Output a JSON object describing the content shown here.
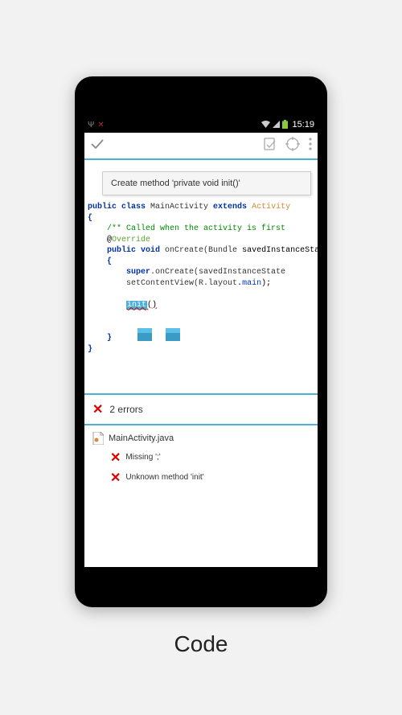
{
  "status_bar": {
    "clock": "15:19"
  },
  "toolbar": {},
  "suggestion": {
    "text": "Create method 'private void init()'"
  },
  "code": {
    "l1a": "public",
    "l1b": " class",
    "l1c": " MainActivity",
    "l1d": " extends",
    "l1e": " Activity",
    "l2": "{",
    "l3": "    /** Called when the activity is first",
    "l4a": "    @",
    "l4b": "Override",
    "l5a": "    public",
    "l5b": " void",
    "l5c": " onCreate(",
    "l5d": "Bundle",
    "l5e": " savedInstanceState",
    "l6": "    {",
    "l7a": "        super",
    "l7b": ".onCreate(savedInstanceState",
    "l8a": "        setContentView(R.",
    "l8b": "layout",
    "l8c": ".",
    "l8d": "main",
    "l8e": ");",
    "l10a": "        ",
    "l10b": "init",
    "l10c": "()",
    "l11": "    }",
    "l12": "}"
  },
  "errors": {
    "header": "2 errors",
    "file": "MainActivity.java",
    "items": [
      "Missing ';'",
      "Unknown method 'init'"
    ]
  },
  "caption": "Code"
}
